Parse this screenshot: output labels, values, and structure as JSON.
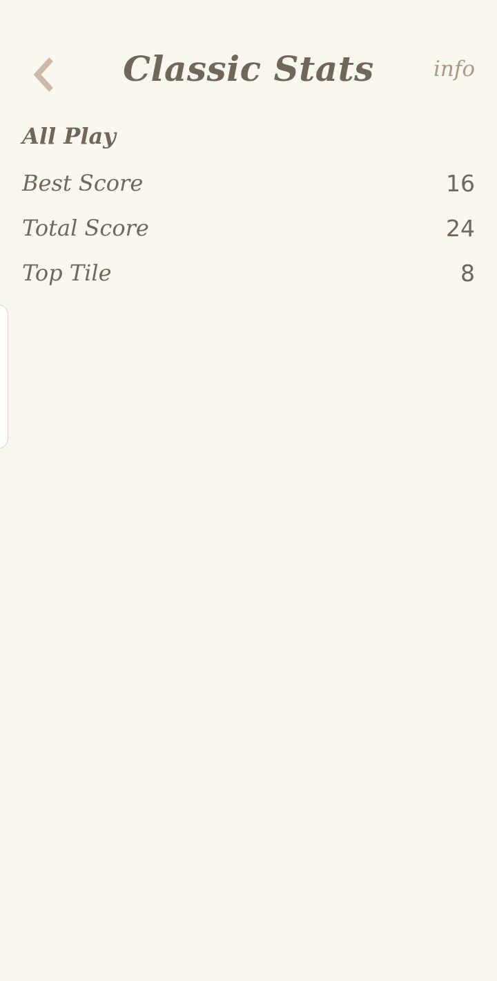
{
  "header": {
    "title": "Classic Stats",
    "info_label": "info",
    "back_icon": "chevron-left-icon"
  },
  "section": {
    "heading": "All Play",
    "stats": [
      {
        "label": "Best Score",
        "value": "16"
      },
      {
        "label": "Total Score",
        "value": "24"
      },
      {
        "label": "Top Tile",
        "value": "8"
      }
    ]
  },
  "colors": {
    "background": "#faf7ef",
    "text": "#6f665c",
    "accent_muted": "#a89a8a",
    "back_icon": "#c9b9a8"
  }
}
